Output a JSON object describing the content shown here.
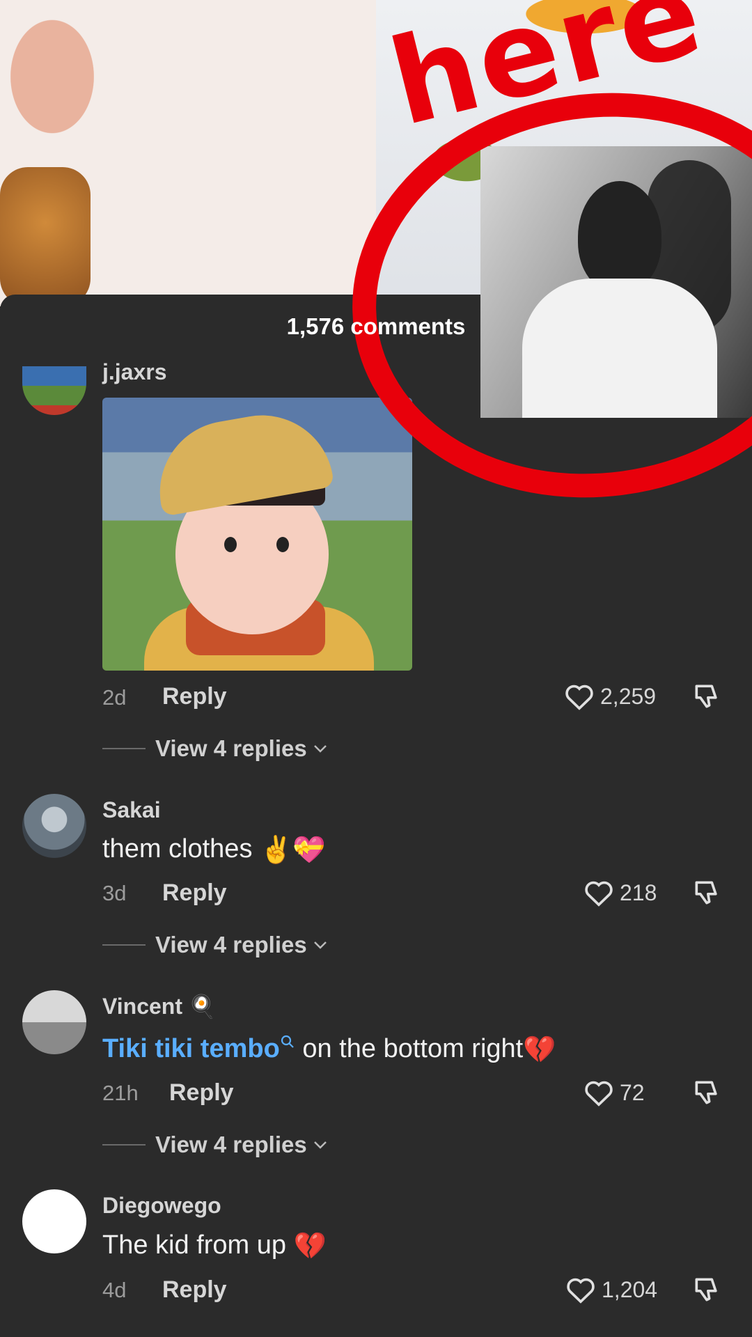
{
  "video": {
    "overlay_text": "here"
  },
  "sheet": {
    "title": "1,576 comments"
  },
  "comments": [
    {
      "username": "j.jaxrs",
      "time": "2d",
      "reply_label": "Reply",
      "likes": "2,259",
      "view_replies": "View 4 replies",
      "has_gif": true
    },
    {
      "username": "Sakai",
      "text": "them clothes",
      "emoji": "✌️💝",
      "time": "3d",
      "reply_label": "Reply",
      "likes": "218",
      "view_replies": "View 4 replies"
    },
    {
      "username": "Vincent",
      "username_emoji": "🍳",
      "text_link": "Tiki tiki tembo",
      "text": "on the bottom right",
      "emoji": "💔",
      "time": "21h",
      "reply_label": "Reply",
      "likes": "72",
      "view_replies": "View 4 replies"
    },
    {
      "username": "Diegowego",
      "text": "The kid from up",
      "emoji": "💔",
      "time": "4d",
      "reply_label": "Reply",
      "likes": "1,204"
    }
  ],
  "colors": {
    "background": "#2b2b2b",
    "link": "#5aaeff",
    "accent_red": "#e8000b"
  }
}
